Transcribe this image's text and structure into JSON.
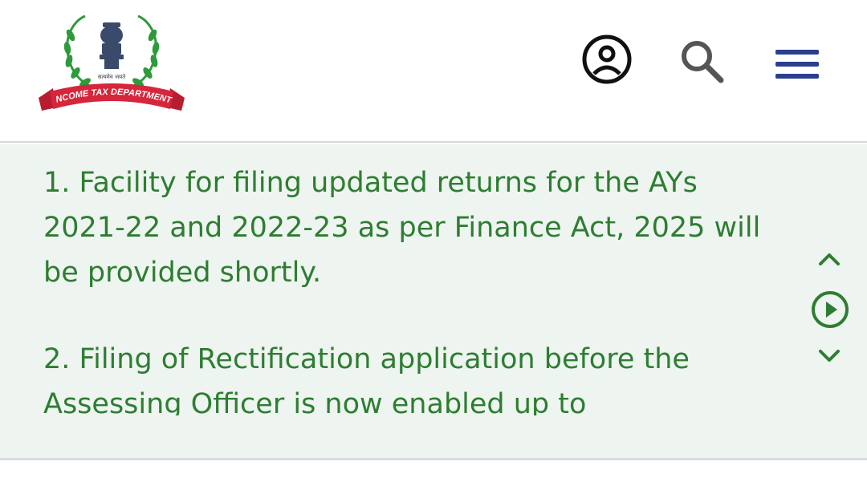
{
  "header": {
    "logo_text": "INCOME TAX DEPARTMENT",
    "logo_motto": "सत्यमेव जयते",
    "icons": {
      "profile": "user-circle-icon",
      "search": "search-icon",
      "menu": "hamburger-menu-icon"
    }
  },
  "ticker": {
    "items": [
      "1. Facility for filing updated returns for the AYs 2021-22 and 2022-23 as per Finance Act, 2025 will be provided shortly.",
      "2. Filing of Rectification application before the Assessing Officer is now enabled up to"
    ],
    "controls": {
      "up": "chevron-up-icon",
      "play": "play-circle-icon",
      "down": "chevron-down-icon"
    }
  },
  "colors": {
    "ticker_text": "#2e7d32",
    "ticker_bg": "#eef4f0",
    "menu_icon": "#2b3f8f",
    "ribbon_red": "#d6263b",
    "emblem_green": "#2e9a3b"
  }
}
